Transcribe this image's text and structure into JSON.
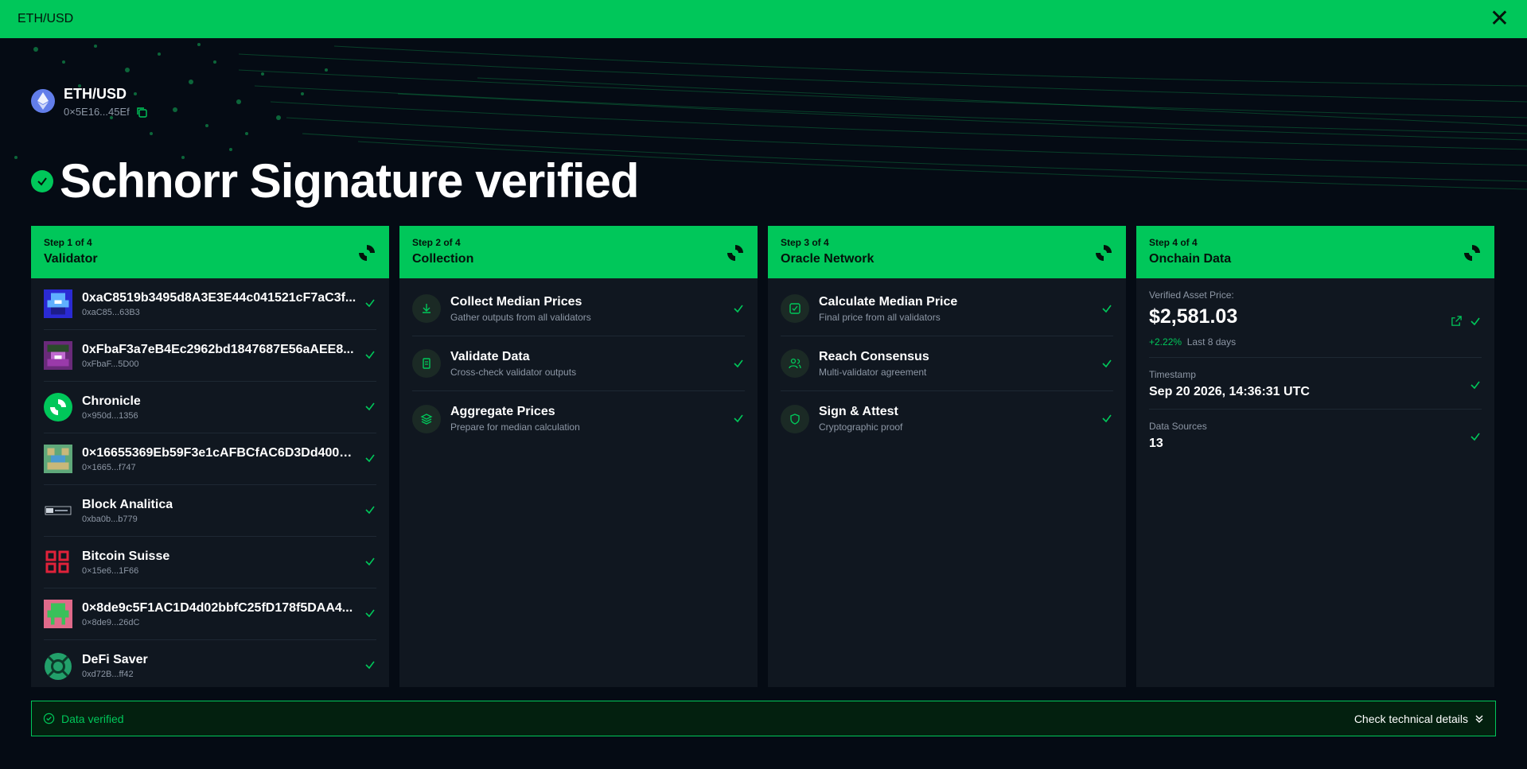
{
  "window": {
    "title": "ETH/USD"
  },
  "asset": {
    "name": "ETH/USD",
    "address": "0×5E16...45Ef"
  },
  "hero": {
    "title": "Schnorr Signature verified"
  },
  "colors": {
    "accent": "#00c75a",
    "bg": "#050b14",
    "panel": "#101720"
  },
  "columns": [
    {
      "step": "Step 1 of 4",
      "title": "Validator"
    },
    {
      "step": "Step 2 of 4",
      "title": "Collection"
    },
    {
      "step": "Step 3 of 4",
      "title": "Oracle Network"
    },
    {
      "step": "Step 4 of 4",
      "title": "Onchain Data"
    }
  ],
  "validators": [
    {
      "name": "0xaC8519b3495d8A3E3E44c041521cF7aC3f...",
      "short": "0xaC85...63B3",
      "icon": "pixel-avatar-blue"
    },
    {
      "name": "0xFbaF3a7eB4Ec2962bd1847687E56aAEE8...",
      "short": "0xFbaF...5D00",
      "icon": "pixel-avatar-purple"
    },
    {
      "name": "Chronicle",
      "short": "0×950d...1356",
      "icon": "chronicle-logo"
    },
    {
      "name": "0×16655369Eb59F3e1cAFBCfAC6D3Dd4001...",
      "short": "0×1665...f747",
      "icon": "pixel-avatar-teal"
    },
    {
      "name": "Block Analitica",
      "short": "0xba0b...b779",
      "icon": "block-analitica-logo"
    },
    {
      "name": "Bitcoin Suisse",
      "short": "0×15e6...1F66",
      "icon": "bitcoin-suisse-logo"
    },
    {
      "name": "0×8de9c5F1AC1D4d02bbfC25fD178f5DAA4...",
      "short": "0×8de9...26dC",
      "icon": "pixel-avatar-green"
    },
    {
      "name": "DeFi Saver",
      "short": "0xd72B...ff42",
      "icon": "defi-saver-logo"
    }
  ],
  "collection": [
    {
      "title": "Collect Median Prices",
      "sub": "Gather outputs from all validators",
      "icon": "download-icon"
    },
    {
      "title": "Validate Data",
      "sub": "Cross-check validator outputs",
      "icon": "document-icon"
    },
    {
      "title": "Aggregate Prices",
      "sub": "Prepare for median calculation",
      "icon": "layers-icon"
    }
  ],
  "oracle": [
    {
      "title": "Calculate Median Price",
      "sub": "Final price from all validators",
      "icon": "check-square-icon"
    },
    {
      "title": "Reach Consensus",
      "sub": "Multi-validator agreement",
      "icon": "users-icon"
    },
    {
      "title": "Sign & Attest",
      "sub": "Cryptographic proof",
      "icon": "shield-icon"
    }
  ],
  "onchain": {
    "price_label": "Verified Asset Price:",
    "price": "$2,581.03",
    "change": "+2.22%",
    "change_period": "Last 8 days",
    "timestamp_label": "Timestamp",
    "timestamp": "Sep 20 2026, 14:36:31 UTC",
    "sources_label": "Data Sources",
    "sources": "13"
  },
  "footer": {
    "status": "Data verified",
    "details": "Check technical details"
  }
}
